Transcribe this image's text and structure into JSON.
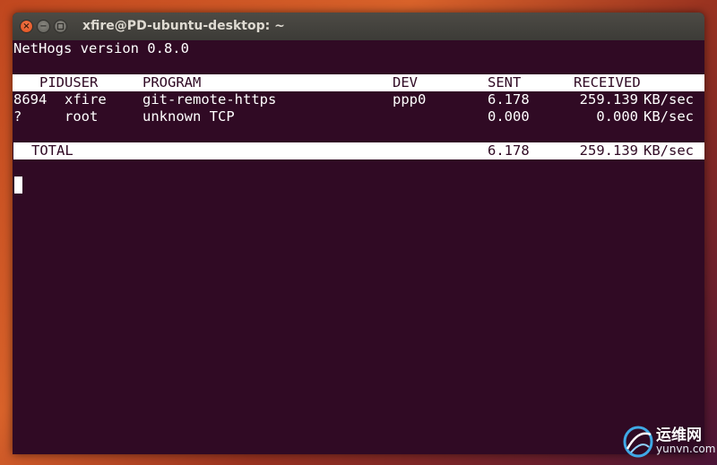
{
  "window": {
    "title": "xfire@PD-ubuntu-desktop: ~",
    "controls": {
      "close": "×",
      "minimize": "−"
    }
  },
  "terminal": {
    "version_line": "NetHogs version 0.8.0",
    "headers": {
      "pid": "PID",
      "user": "USER",
      "program": "PROGRAM",
      "dev": "DEV",
      "sent": "SENT",
      "received": "RECEIVED"
    },
    "rows": [
      {
        "pid": "8694",
        "user": "xfire",
        "program": "git-remote-https",
        "dev": "ppp0",
        "sent": "6.178",
        "received": "259.139",
        "unit": "KB/sec"
      },
      {
        "pid": "?",
        "user": "root",
        "program": "unknown TCP",
        "dev": "",
        "sent": "0.000",
        "received": "0.000",
        "unit": "KB/sec"
      }
    ],
    "total": {
      "label": "TOTAL",
      "sent": "6.178",
      "received": "259.139",
      "unit": "KB/sec"
    }
  },
  "watermark": {
    "brand": "运维网",
    "url": "yunvn.com"
  },
  "colors": {
    "terminal_bg": "#300a24",
    "terminal_fg": "#ffffff",
    "titlebar": "#3c3b37",
    "close_button": "#de4a17"
  }
}
